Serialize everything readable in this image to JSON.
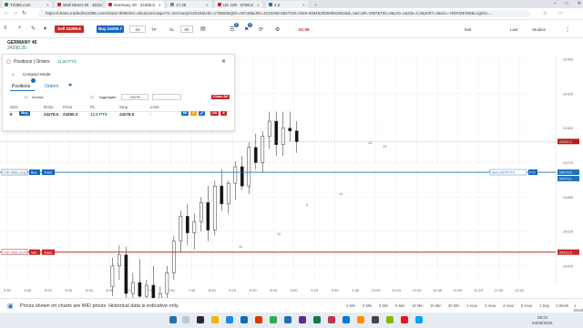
{
  "browser": {
    "tabs": [
      {
        "title": "T2365.com",
        "color": "#1f8a4c",
        "active": false
      },
      {
        "title": "Wall Street 30 · 40315(0)",
        "color": "#c62828",
        "active": false
      },
      {
        "title": "Germany 40 · 24290.0",
        "color": "#c62828",
        "active": true
      },
      {
        "title": "17.28",
        "color": "#888888",
        "active": false
      },
      {
        "title": "UK 100 · 8790.8",
        "color": "#c62828",
        "active": false
      },
      {
        "title": "4.0",
        "color": "#1e73be",
        "active": false
      }
    ],
    "url": "https://charts.tradedirect365.com/charts-tb950/inc-advanced.aspx?S=Germany%2040&UID=170683&QID=00748&UID=4233468-5827016-1926-8384620559591952&d=1&CUR=GBP&TID=0&LID=1&CB=1.0&2007=4&vis=-HORIZEW0&Login0=..."
  },
  "toolbar": {
    "sell_label": "Sell 24289.6",
    "buy_label": "Buy 24290.7",
    "stake_value": "16",
    "tp_label": "TP",
    "sl_label": "SL",
    "sl_value": "60",
    "badge_one": "1",
    "badge_two": "1",
    "spread": "01:08",
    "mid_label": "Mid",
    "last_label": "Last",
    "studies_label": "Studies"
  },
  "instrument": {
    "name": "GERMANY 40",
    "price": "24290.25"
  },
  "panel": {
    "title": "Positions | Orders",
    "pts": "11.60 PTS",
    "compact_mode": "Compact Mode",
    "tab_positions": "Positions",
    "tab_orders": "Orders",
    "positions_count": "1",
    "arrows_label": "Arrows",
    "aggregate_label": "Aggregate",
    "aggregate_value": "24278",
    "close_all": "Close All",
    "columns": [
      "Size",
      "Entry",
      "Price",
      "PL",
      "Stop",
      "Limit"
    ],
    "row": {
      "size": "8",
      "direction": "Buy",
      "entry": "24278.0",
      "price": "24290.3",
      "pl": "12.6 PTS",
      "stop": "24278.0",
      "limit": "-"
    },
    "row_buttons": [
      "SE",
      "O",
      "⤢",
      "OX",
      "X"
    ]
  },
  "chart_data": {
    "type": "candlestick",
    "time_labels": [
      "5:30",
      "5:45",
      "6:00",
      "6:15",
      "6:30",
      "6:45",
      "7:00",
      "7:15",
      "7:30",
      "7:45",
      "8:00",
      "8:15",
      "8:30",
      "8:45",
      "9:00",
      "9:15",
      "9:30",
      "9:45",
      "10:00",
      "10:15",
      "10:30",
      "10:45",
      "11:00",
      "11:15",
      "11:30",
      "11:45"
    ],
    "price_axis": [
      "24350",
      "24325",
      "24300",
      "24275",
      "24250",
      "24225",
      "24200"
    ],
    "lines": [
      {
        "label": "OHI SMS Long",
        "price": 24268,
        "color": "#1e73be",
        "price_tag": "24274.5",
        "price_tag_2": "24273.1"
      },
      {
        "label": "OHI SMS Short",
        "price": 24210,
        "color": "#c62828",
        "price_tag": "24210.3"
      }
    ],
    "current_price_tag": "24290.3",
    "line_buttons": {
      "buy": "Buy",
      "trade": "Trade",
      "sell": "Sell",
      "alert": "Alert 24274 PTS",
      "pts": "PTS",
      "ext": "24274.25"
    },
    "candles": [
      {
        "t": "6:47",
        "o": 24185,
        "h": 24206,
        "l": 24178,
        "c": 24200
      },
      {
        "t": "6:52",
        "o": 24200,
        "h": 24215,
        "l": 24190,
        "c": 24208
      },
      {
        "t": "6:57",
        "o": 24208,
        "h": 24214,
        "l": 24175,
        "c": 24180
      },
      {
        "t": "7:02",
        "o": 24180,
        "h": 24195,
        "l": 24168,
        "c": 24188
      },
      {
        "t": "7:07",
        "o": 24188,
        "h": 24205,
        "l": 24175,
        "c": 24178
      },
      {
        "t": "7:12",
        "o": 24178,
        "h": 24190,
        "l": 24170,
        "c": 24186
      },
      {
        "t": "7:17",
        "o": 24186,
        "h": 24200,
        "l": 24172,
        "c": 24175
      },
      {
        "t": "7:22",
        "o": 24175,
        "h": 24185,
        "l": 24170,
        "c": 24180
      },
      {
        "t": "7:27",
        "o": 24180,
        "h": 24200,
        "l": 24176,
        "c": 24195
      },
      {
        "t": "7:32",
        "o": 24195,
        "h": 24222,
        "l": 24190,
        "c": 24218
      },
      {
        "t": "7:37",
        "o": 24218,
        "h": 24240,
        "l": 24210,
        "c": 24236
      },
      {
        "t": "7:42",
        "o": 24236,
        "h": 24245,
        "l": 24215,
        "c": 24224
      },
      {
        "t": "7:47",
        "o": 24224,
        "h": 24238,
        "l": 24212,
        "c": 24232
      },
      {
        "t": "7:52",
        "o": 24232,
        "h": 24250,
        "l": 24225,
        "c": 24246
      },
      {
        "t": "7:57",
        "o": 24246,
        "h": 24258,
        "l": 24218,
        "c": 24226
      },
      {
        "t": "8:02",
        "o": 24226,
        "h": 24262,
        "l": 24222,
        "c": 24258
      },
      {
        "t": "8:07",
        "o": 24258,
        "h": 24270,
        "l": 24240,
        "c": 24245
      },
      {
        "t": "8:12",
        "o": 24245,
        "h": 24262,
        "l": 24238,
        "c": 24260
      },
      {
        "t": "8:17",
        "o": 24260,
        "h": 24276,
        "l": 24248,
        "c": 24272
      },
      {
        "t": "8:22",
        "o": 24272,
        "h": 24280,
        "l": 24255,
        "c": 24258
      },
      {
        "t": "8:27",
        "o": 24258,
        "h": 24290,
        "l": 24252,
        "c": 24286
      },
      {
        "t": "8:32",
        "o": 24286,
        "h": 24296,
        "l": 24270,
        "c": 24275
      },
      {
        "t": "8:37",
        "o": 24275,
        "h": 24298,
        "l": 24268,
        "c": 24294
      },
      {
        "t": "8:42",
        "o": 24294,
        "h": 24312,
        "l": 24285,
        "c": 24305
      },
      {
        "t": "8:47",
        "o": 24305,
        "h": 24312,
        "l": 24280,
        "c": 24288
      },
      {
        "t": "8:52",
        "o": 24288,
        "h": 24312,
        "l": 24280,
        "c": 24300
      },
      {
        "t": "8:57",
        "o": 24300,
        "h": 24312,
        "l": 24290,
        "c": 24298
      },
      {
        "t": "9:02",
        "o": 24298,
        "h": 24305,
        "l": 24282,
        "c": 24290
      }
    ],
    "candle_labels": [
      "2",
      "11",
      "11",
      "12",
      "13",
      "13"
    ]
  },
  "footer": {
    "notice": "Prices shown on charts are MID prices. Historical data is indicative only.",
    "timeframes": [
      "1 Min",
      "2 Min",
      "3 Min",
      "5 Min",
      "10 Min",
      "15 Min",
      "30 Min",
      "1 Hour",
      "2 Hour",
      "4 Hour",
      "6 Hour",
      "1 Day",
      "1 Week",
      "1 Month"
    ]
  },
  "taskbar": {
    "time": "09:22",
    "date": "04/08/2025"
  }
}
